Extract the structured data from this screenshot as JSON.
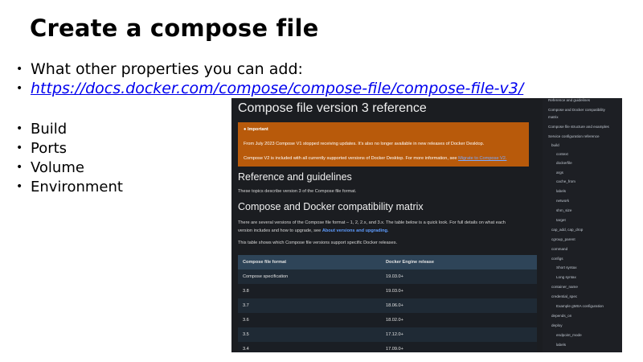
{
  "slide": {
    "title": "Create a compose file",
    "intro_bullets": [
      {
        "text": "What other properties you can add:"
      },
      {
        "text": "https://docs.docker.com/compose/compose-file/compose-file-v3/"
      }
    ],
    "properties": [
      "Build",
      "Ports",
      "Volume",
      "Environment"
    ]
  },
  "docs": {
    "page_title": "Compose file version 3 reference",
    "important": {
      "title": "Important",
      "line1": "From July 2023 Compose V1 stopped receiving updates. It's also no longer available in new releases of Docker Desktop.",
      "line2": "Compose V2 is included with all currently supported versions of Docker Desktop. For more information, see",
      "line2_link": "Migrate to Compose V2."
    },
    "reference_heading": "Reference and guidelines",
    "reference_text": "These topics describe version 3 of the Compose file format.",
    "compat_heading": "Compose and Docker compatibility matrix",
    "compat_text1": "There are several versions of the Compose file format – 1, 2, 2.x, and 3.x. The table below is a quick look. For full details on what each",
    "compat_text2": "version includes and how to upgrade, see",
    "compat_link": "About versions and upgrading.",
    "compat_text3": "This table shows which Compose file versions support specific Docker releases.",
    "table": {
      "headers": [
        "Compose file format",
        "Docker Engine release"
      ],
      "rows": [
        [
          "Compose specification",
          "19.03.0+"
        ],
        [
          "3.8",
          "19.03.0+"
        ],
        [
          "3.7",
          "18.06.0+"
        ],
        [
          "3.6",
          "18.02.0+"
        ],
        [
          "3.5",
          "17.12.0+"
        ],
        [
          "3.4",
          "17.09.0+"
        ]
      ]
    },
    "sidebar": [
      "Reference and guidelines",
      "Compose and Docker compatibility",
      "matrix",
      "Compose file structure and examples",
      "Service configuration reference",
      "build",
      "context",
      "dockerfile",
      "args",
      "cache_from",
      "labels",
      "network",
      "shm_size",
      "target",
      "cap_add, cap_drop",
      "cgroup_parent",
      "command",
      "configs",
      "Short syntax",
      "Long syntax",
      "container_name",
      "credential_spec",
      "Example gMSA configuration",
      "depends_on",
      "deploy",
      "endpoint_mode",
      "labels"
    ]
  }
}
